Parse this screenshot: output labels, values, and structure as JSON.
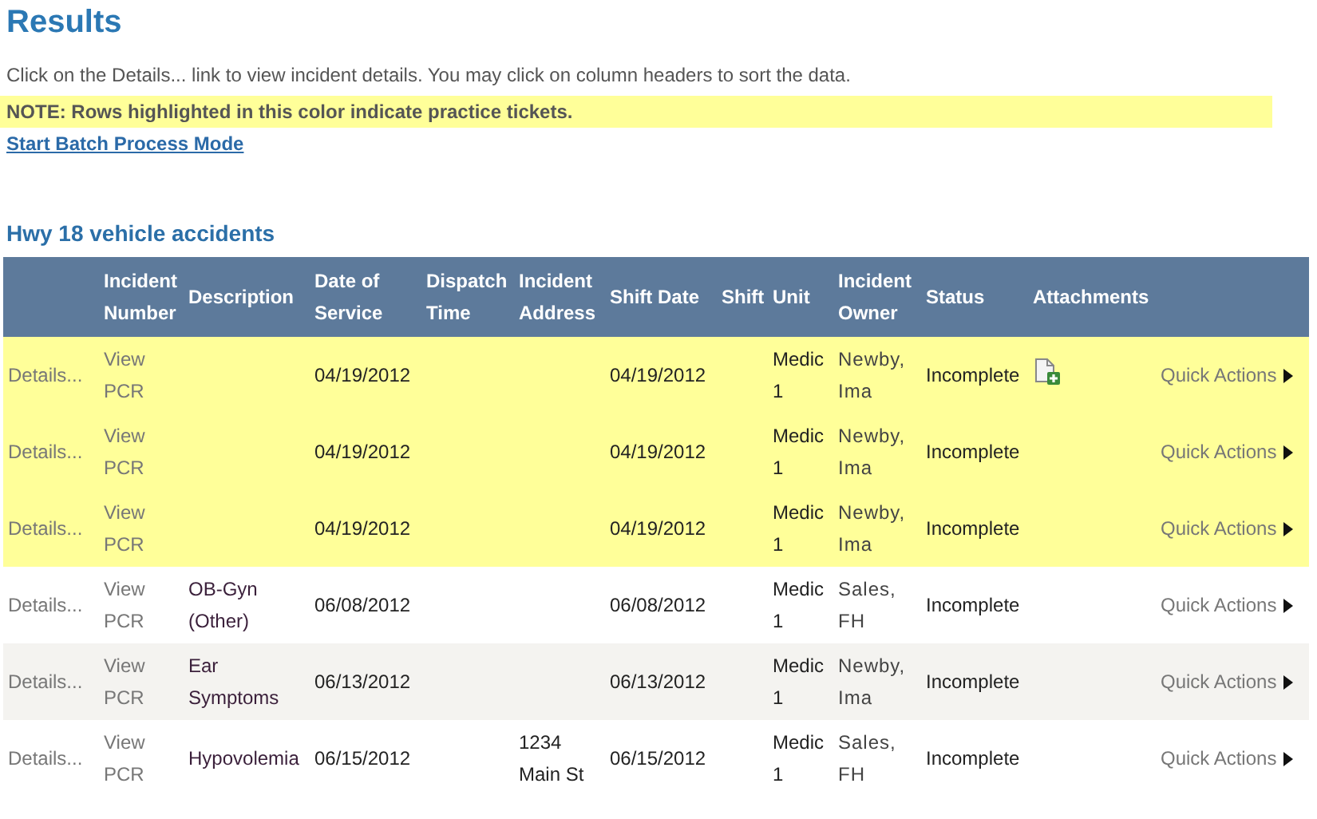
{
  "title": "Results",
  "instructions": "Click on the Details... link to view incident details. You may click on column headers to sort the data.",
  "note": "NOTE: Rows highlighted in this color indicate practice tickets.",
  "batch_link": "Start Batch Process Mode",
  "table": {
    "title": "Hwy 18 vehicle accidents",
    "columns": [
      "Incident Number",
      "Description",
      "Date of Service",
      "Dispatch Time",
      "Incident Address",
      "Shift Date",
      "Shift",
      "Unit",
      "Incident Owner",
      "Status",
      "Attachments"
    ],
    "rows": [
      {
        "practice": true,
        "details": "Details...",
        "view": "View PCR",
        "date_of_service": "04/19/2012",
        "shift_date": "04/19/2012",
        "unit": "Medic 1",
        "owner": "Newby, Ima",
        "status": "Incomplete",
        "attachment": true,
        "quick_actions": "Quick Actions"
      },
      {
        "practice": true,
        "details": "Details...",
        "view": "View PCR",
        "date_of_service": "04/19/2012",
        "shift_date": "04/19/2012",
        "unit": "Medic 1",
        "owner": "Newby, Ima",
        "status": "Incomplete",
        "attachment": false,
        "quick_actions": "Quick Actions"
      },
      {
        "practice": true,
        "details": "Details...",
        "view": "View PCR",
        "date_of_service": "04/19/2012",
        "shift_date": "04/19/2012",
        "unit": "Medic 1",
        "owner": "Newby, Ima",
        "status": "Incomplete",
        "attachment": false,
        "quick_actions": "Quick Actions"
      },
      {
        "practice": false,
        "details": "Details...",
        "view": "View PCR",
        "description": "OB-Gyn (Other)",
        "date_of_service": "06/08/2012",
        "shift_date": "06/08/2012",
        "unit": "Medic 1",
        "owner": "Sales, FH",
        "status": "Incomplete",
        "attachment": false,
        "quick_actions": "Quick Actions"
      },
      {
        "practice": false,
        "details": "Details...",
        "view": "View PCR",
        "description": "Ear Symptoms",
        "date_of_service": "06/13/2012",
        "shift_date": "06/13/2012",
        "unit": "Medic 1",
        "owner": "Newby, Ima",
        "status": "Incomplete",
        "attachment": false,
        "quick_actions": "Quick Actions"
      },
      {
        "practice": false,
        "details": "Details...",
        "view": "View PCR",
        "description": "Hypovolemia",
        "date_of_service": "06/15/2012",
        "address": "1234 Main St",
        "shift_date": "06/15/2012",
        "unit": "Medic 1",
        "owner": "Sales, FH",
        "status": "Incomplete",
        "attachment": false,
        "quick_actions": "Quick Actions"
      }
    ]
  }
}
